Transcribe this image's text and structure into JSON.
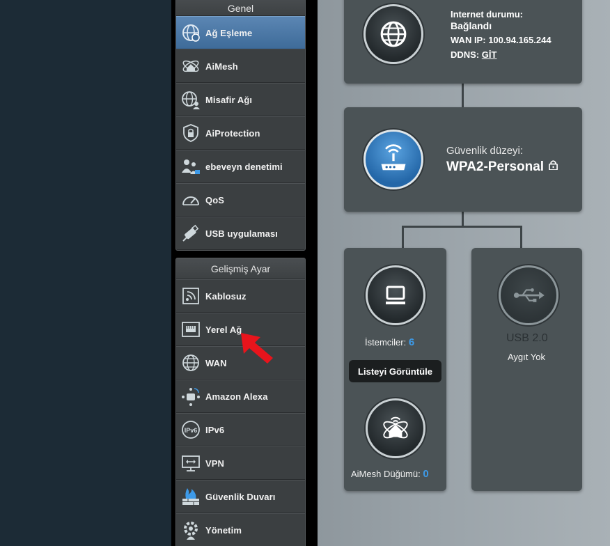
{
  "sidebar": {
    "general": {
      "header": "Genel",
      "items": [
        {
          "label": "Ağ Eşleme",
          "icon": "network-map-icon",
          "active": true
        },
        {
          "label": "AiMesh",
          "icon": "aimesh-icon",
          "active": false
        },
        {
          "label": "Misafir Ağı",
          "icon": "guest-network-icon",
          "active": false
        },
        {
          "label": "AiProtection",
          "icon": "shield-lock-icon",
          "active": false
        },
        {
          "label": "ebeveyn denetimi",
          "icon": "parental-control-icon",
          "active": false
        },
        {
          "label": "QoS",
          "icon": "speedometer-icon",
          "active": false
        },
        {
          "label": "USB uygulaması",
          "icon": "usb-app-icon",
          "active": false
        }
      ]
    },
    "advanced": {
      "header": "Gelişmiş Ayar",
      "items": [
        {
          "label": "Kablosuz",
          "icon": "wireless-icon"
        },
        {
          "label": "Yerel Ağ",
          "icon": "lan-port-icon"
        },
        {
          "label": "WAN",
          "icon": "globe-icon"
        },
        {
          "label": "Amazon Alexa",
          "icon": "alexa-icon"
        },
        {
          "label": "IPv6",
          "icon": "ipv6-icon"
        },
        {
          "label": "VPN",
          "icon": "vpn-icon"
        },
        {
          "label": "Güvenlik Duvarı",
          "icon": "firewall-icon"
        },
        {
          "label": "Yönetim",
          "icon": "gear-icon"
        }
      ]
    }
  },
  "internet": {
    "status_label": "Internet durumu:",
    "status_value": "Bağlandı",
    "wan_ip_label": "WAN IP:",
    "wan_ip_value": "100.94.165.244",
    "ddns_label": "DDNS:",
    "ddns_link": "GİT"
  },
  "router": {
    "security_label": "Güvenlik düzeyi:",
    "security_value": "WPA2-Personal"
  },
  "clients": {
    "label": "İstemciler:",
    "count": "6",
    "view_list_button": "Listeyi Görüntüle",
    "aimesh_label": "AiMesh Düğümü:",
    "aimesh_count": "0"
  },
  "usb": {
    "title": "USB 2.0",
    "status": "Aygıt Yok"
  },
  "colors": {
    "accent_blue": "#3d9ae8",
    "active_menu": "#4a77a6",
    "annotation_arrow": "#e8141c"
  }
}
